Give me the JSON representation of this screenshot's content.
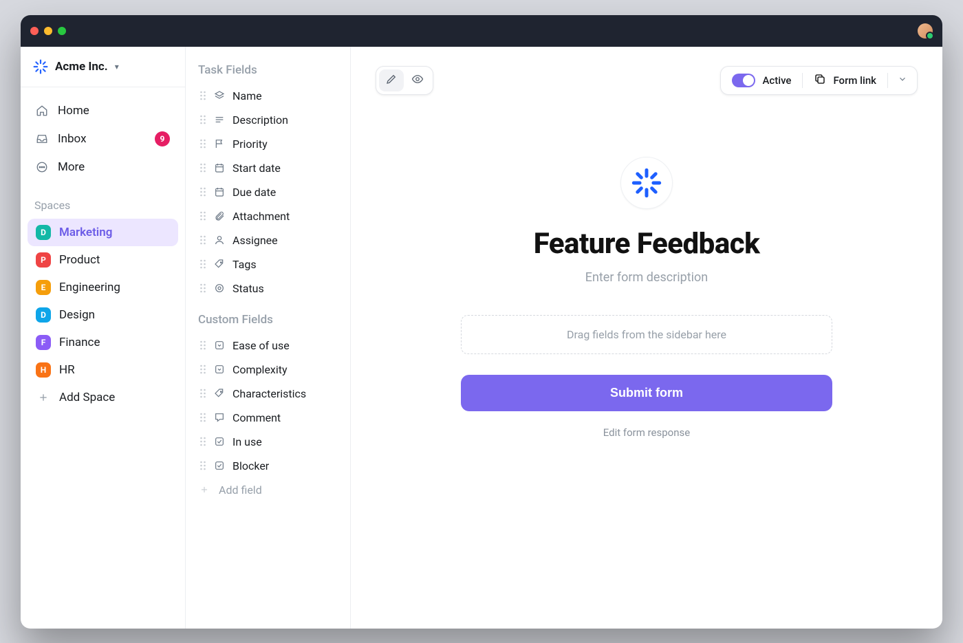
{
  "workspace": {
    "name": "Acme Inc."
  },
  "nav": {
    "items": [
      {
        "label": "Home",
        "icon": "home"
      },
      {
        "label": "Inbox",
        "icon": "inbox",
        "badge": "9"
      },
      {
        "label": "More",
        "icon": "more"
      }
    ],
    "spaces_label": "Spaces",
    "add_space_label": "Add Space"
  },
  "spaces": [
    {
      "letter": "D",
      "label": "Marketing",
      "color": "#14b8a6",
      "active": true
    },
    {
      "letter": "P",
      "label": "Product",
      "color": "#ef4444"
    },
    {
      "letter": "E",
      "label": "Engineering",
      "color": "#f59e0b"
    },
    {
      "letter": "D",
      "label": "Design",
      "color": "#0ea5e9"
    },
    {
      "letter": "F",
      "label": "Finance",
      "color": "#8b5cf6"
    },
    {
      "letter": "H",
      "label": "HR",
      "color": "#f97316"
    }
  ],
  "fields_panel": {
    "task_header": "Task Fields",
    "custom_header": "Custom Fields",
    "add_field_label": "Add field",
    "task_fields": [
      {
        "label": "Name",
        "icon": "layers"
      },
      {
        "label": "Description",
        "icon": "text"
      },
      {
        "label": "Priority",
        "icon": "flag"
      },
      {
        "label": "Start date",
        "icon": "calendar"
      },
      {
        "label": "Due date",
        "icon": "calendar"
      },
      {
        "label": "Attachment",
        "icon": "paperclip"
      },
      {
        "label": "Assignee",
        "icon": "person"
      },
      {
        "label": "Tags",
        "icon": "tag"
      },
      {
        "label": "Status",
        "icon": "target"
      }
    ],
    "custom_fields": [
      {
        "label": "Ease of use",
        "icon": "dropdown"
      },
      {
        "label": "Complexity",
        "icon": "dropdown"
      },
      {
        "label": "Characteristics",
        "icon": "tag"
      },
      {
        "label": "Comment",
        "icon": "comment"
      },
      {
        "label": "In use",
        "icon": "checkbox"
      },
      {
        "label": "Blocker",
        "icon": "checkbox"
      }
    ]
  },
  "canvas": {
    "status_toggle_label": "Active",
    "form_link_label": "Form link",
    "form_title": "Feature Feedback",
    "form_description_placeholder": "Enter form description",
    "dropzone_hint": "Drag fields from the sidebar here",
    "submit_label": "Submit form",
    "edit_response_label": "Edit form response"
  },
  "colors": {
    "accent": "#7b68ee",
    "badge": "#e61e64"
  }
}
